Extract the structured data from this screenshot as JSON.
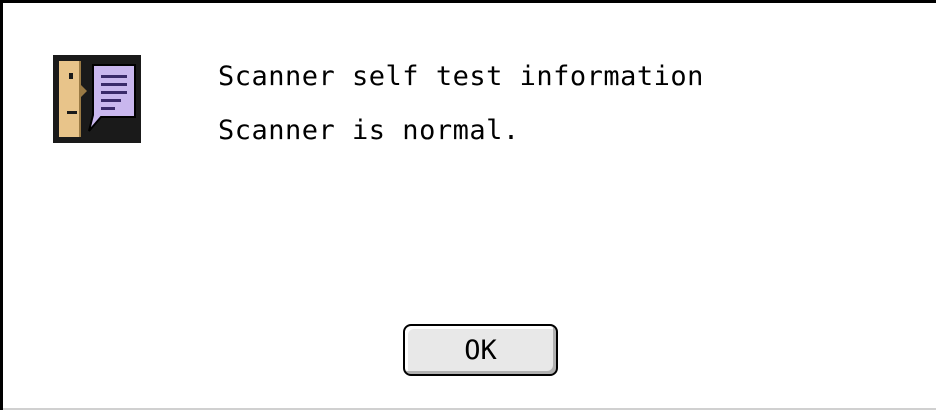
{
  "dialog": {
    "icon": "note-speech-icon",
    "title": "Scanner self test information",
    "message": "Scanner is normal.",
    "ok_label": "OK"
  },
  "colors": {
    "icon_face": "#e8c48a",
    "icon_bubble": "#c9b7ee",
    "icon_background": "#1a1a1a"
  }
}
